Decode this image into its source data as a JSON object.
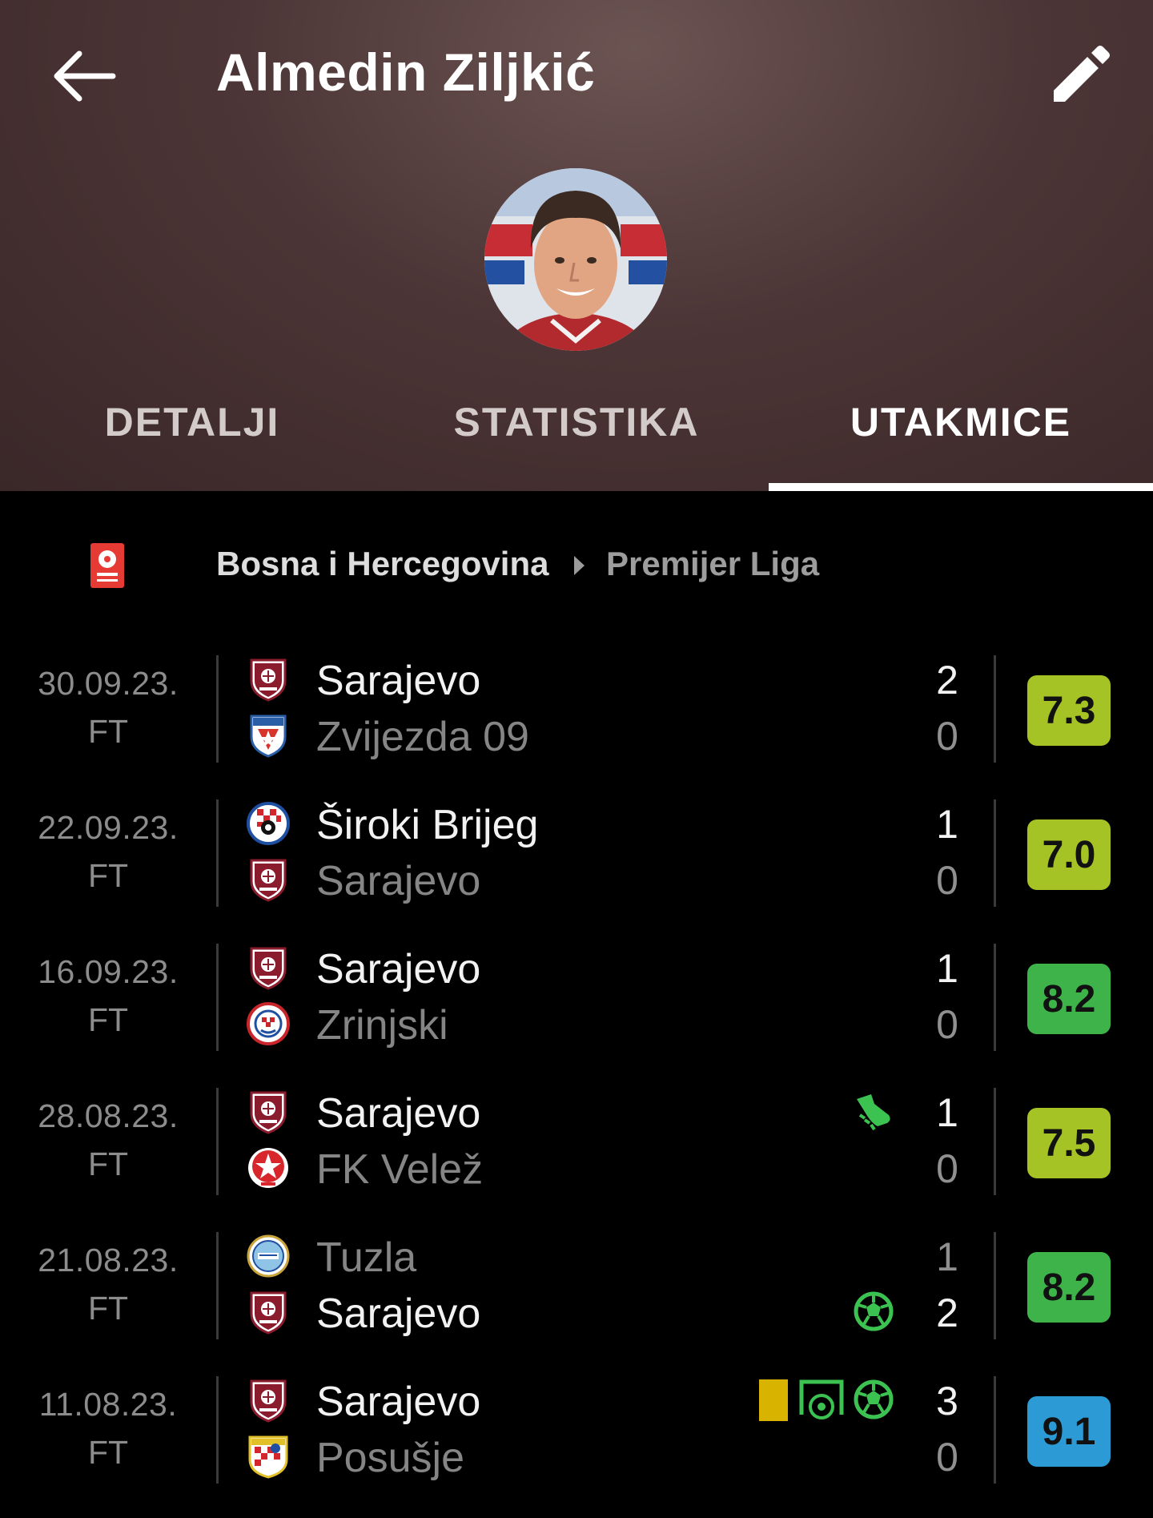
{
  "header": {
    "player_name": "Almedin Ziljkić",
    "back_icon": "arrow-left-icon",
    "edit_icon": "pencil-icon",
    "tabs": [
      "DETALJI",
      "STATISTIKA",
      "UTAKMICE"
    ],
    "active_tab": "UTAKMICE"
  },
  "league": {
    "country": "Bosna i Hercegovina",
    "name": "Premijer Liga"
  },
  "matches": [
    {
      "date": "30.09.23.",
      "status": "FT",
      "home": {
        "name": "Sarajevo",
        "score": "2",
        "winner": true
      },
      "away": {
        "name": "Zvijezda 09",
        "score": "0",
        "winner": false
      },
      "rating": "7.3",
      "rating_color": "#a5c325",
      "events": []
    },
    {
      "date": "22.09.23.",
      "status": "FT",
      "home": {
        "name": "Široki Brijeg",
        "score": "1",
        "winner": true
      },
      "away": {
        "name": "Sarajevo",
        "score": "0",
        "winner": false
      },
      "rating": "7.0",
      "rating_color": "#a5c325",
      "events": []
    },
    {
      "date": "16.09.23.",
      "status": "FT",
      "home": {
        "name": "Sarajevo",
        "score": "1",
        "winner": true
      },
      "away": {
        "name": "Zrinjski",
        "score": "0",
        "winner": false
      },
      "rating": "8.2",
      "rating_color": "#3db34a",
      "events": []
    },
    {
      "date": "28.08.23.",
      "status": "FT",
      "home": {
        "name": "Sarajevo",
        "score": "1",
        "winner": true
      },
      "away": {
        "name": "FK Velež",
        "score": "0",
        "winner": false
      },
      "rating": "7.5",
      "rating_color": "#a5c325",
      "events": [
        "assist-boot-icon"
      ]
    },
    {
      "date": "21.08.23.",
      "status": "FT",
      "home": {
        "name": "Tuzla",
        "score": "1",
        "winner": false
      },
      "away": {
        "name": "Sarajevo",
        "score": "2",
        "winner": true
      },
      "rating": "8.2",
      "rating_color": "#3db34a",
      "events": [
        "goal-ball-icon"
      ]
    },
    {
      "date": "11.08.23.",
      "status": "FT",
      "home": {
        "name": "Sarajevo",
        "score": "3",
        "winner": true
      },
      "away": {
        "name": "Posušje",
        "score": "0",
        "winner": false
      },
      "rating": "9.1",
      "rating_color": "#2c9ad4",
      "events": [
        "yellow-card-icon",
        "penalty-goal-icon",
        "goal-ball-icon"
      ]
    }
  ],
  "colors": {
    "header_bg": "#4c3536",
    "goal_icon": "#3cc251",
    "yellow_card": "#d8b400"
  }
}
